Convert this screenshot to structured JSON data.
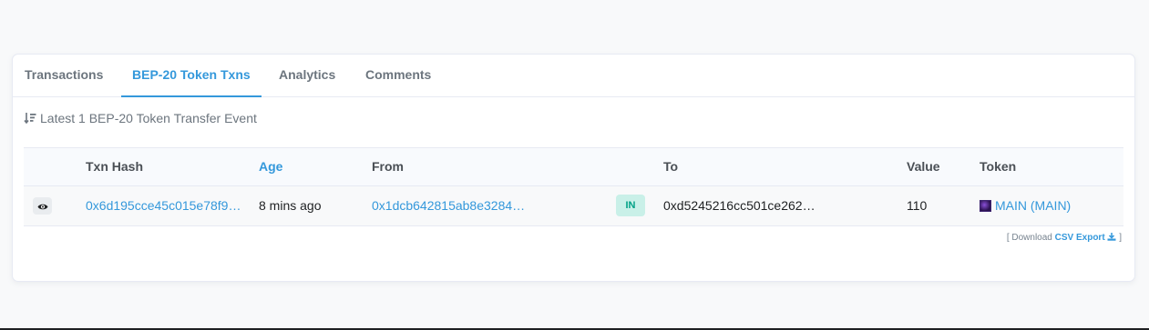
{
  "tabs": [
    {
      "label": "Transactions",
      "active": false
    },
    {
      "label": "BEP-20 Token Txns",
      "active": true
    },
    {
      "label": "Analytics",
      "active": false
    },
    {
      "label": "Comments",
      "active": false
    }
  ],
  "summary": {
    "text": "Latest 1 BEP-20 Token Transfer Event"
  },
  "table": {
    "headers": {
      "txn_hash": "Txn Hash",
      "age": "Age",
      "from": "From",
      "to": "To",
      "value": "Value",
      "token": "Token"
    },
    "rows": [
      {
        "txn_hash": "0x6d195cce45c015e78f9…",
        "age": "8 mins ago",
        "from": "0x1dcb642815ab8e3284…",
        "direction": "IN",
        "to": "0xd5245216cc501ce262…",
        "value": "110",
        "token": "MAIN (MAIN)"
      }
    ]
  },
  "download": {
    "open": "[ Download ",
    "link": "CSV Export",
    "close": " ]"
  },
  "colors": {
    "accent": "#3498db",
    "in_badge_bg": "#c9f0e8",
    "in_badge_text": "#00a186"
  },
  "icons": {
    "sort": "sort-amount-down-icon",
    "eye": "eye-icon",
    "download": "download-icon",
    "token": "main-token-icon"
  }
}
